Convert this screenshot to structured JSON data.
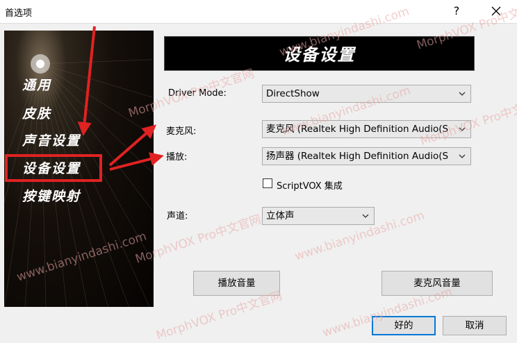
{
  "window": {
    "title": "首选项",
    "help_glyph": "?",
    "close_icon": "close-icon"
  },
  "nav": {
    "items": [
      "通用",
      "皮肤",
      "声音设置",
      "设备设置",
      "按键映射"
    ],
    "active_index": 3
  },
  "banner": {
    "title": "设备设置"
  },
  "device": {
    "driver_mode_label": "Driver Mode:",
    "driver_mode_value": "DirectShow",
    "mic_label": "麦克风:",
    "mic_value": "麦克风 (Realtek High Definition Audio(S",
    "playback_label": "播放:",
    "playback_value": "扬声器 (Realtek High Definition Audio(S",
    "scriptvox_label": "ScriptVOX 集成",
    "scriptvox_checked": false,
    "channel_label": "声道:",
    "channel_value": "立体声"
  },
  "buttons": {
    "playback_volume": "播放音量",
    "mic_volume": "麦克风音量",
    "ok": "好的",
    "cancel": "取消"
  },
  "watermarks": [
    "MorphVOX Pro中文官网",
    "www.bianyindashi.com"
  ],
  "colors": {
    "annotation_red": "#e02222",
    "default_button_border": "#0078d7"
  }
}
